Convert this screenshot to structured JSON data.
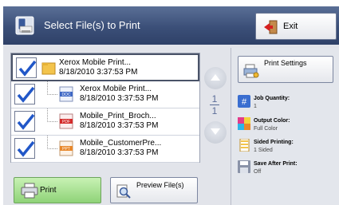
{
  "header": {
    "title": "Select File(s) to Print",
    "exit_label": "Exit"
  },
  "files": [
    {
      "name": "Xerox Mobile Print...",
      "date": "8/18/2010 3:37:53 PM",
      "type": "folder"
    },
    {
      "name": "Xerox Mobile Print...",
      "date": "8/18/2010 3:37:53 PM",
      "type": "DOC"
    },
    {
      "name": "Mobile_Print_Broch...",
      "date": "8/18/2010 3:37:53 PM",
      "type": "PDF"
    },
    {
      "name": "Mobile_CustomerPre...",
      "date": "8/18/2010 3:37:53 PM",
      "type": "PPT"
    }
  ],
  "pagination": {
    "current": "1",
    "total": "1"
  },
  "panel": {
    "print_settings_label": "Print Settings",
    "settings": [
      {
        "label": "Job Quantity:",
        "value": "1",
        "icon": "hash-icon"
      },
      {
        "label": "Output Color:",
        "value": "Full Color",
        "icon": "color-icon"
      },
      {
        "label": "Sided Printing:",
        "value": "1 Sided",
        "icon": "page-icon"
      },
      {
        "label": "Save After Print:",
        "value": "Off",
        "icon": "save-icon"
      }
    ]
  },
  "buttons": {
    "print_label": "Print",
    "preview_label": "Preview File(s)"
  }
}
